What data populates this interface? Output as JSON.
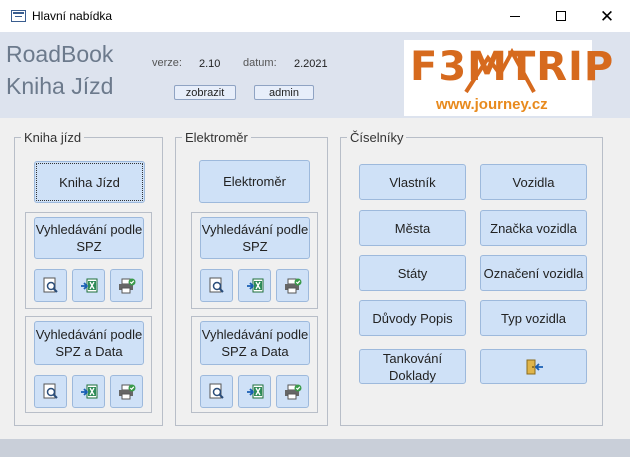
{
  "window": {
    "title": "Hlavní nabídka"
  },
  "header": {
    "brand_line1": "RoadBook",
    "brand_line2": "Kniha Jízd",
    "version_label": "verze:",
    "version_value": "2.10",
    "date_label": "datum:",
    "date_value": "2.2021",
    "show_button": "zobrazit",
    "admin_button": "admin"
  },
  "logo": {
    "text": "F3MTRIP",
    "url": "www.journey.cz"
  },
  "groups": {
    "kniha": {
      "legend": "Kniha jízd",
      "main_button": "Kniha Jízd",
      "search_spz": "Vyhledávání podle SPZ",
      "search_spz_data": "Vyhledávání podle SPZ a Data"
    },
    "elektromer": {
      "legend": "Elektroměr",
      "main_button": "Elektroměr",
      "search_spz": "Vyhledávání podle SPZ",
      "search_spz_data": "Vyhledávání podle SPZ a Data"
    },
    "ciselniky": {
      "legend": "Číselníky",
      "buttons": [
        "Vlastník",
        "Vozidla",
        "Města",
        "Značka vozidla",
        "Státy",
        "Označení vozidla",
        "Důvody Popis",
        "Typ vozidla",
        "Tankování Doklady"
      ]
    }
  },
  "icons": {
    "preview": "print-preview-icon",
    "excel": "excel-export-icon",
    "print": "printer-icon",
    "exit": "exit-door-icon"
  }
}
